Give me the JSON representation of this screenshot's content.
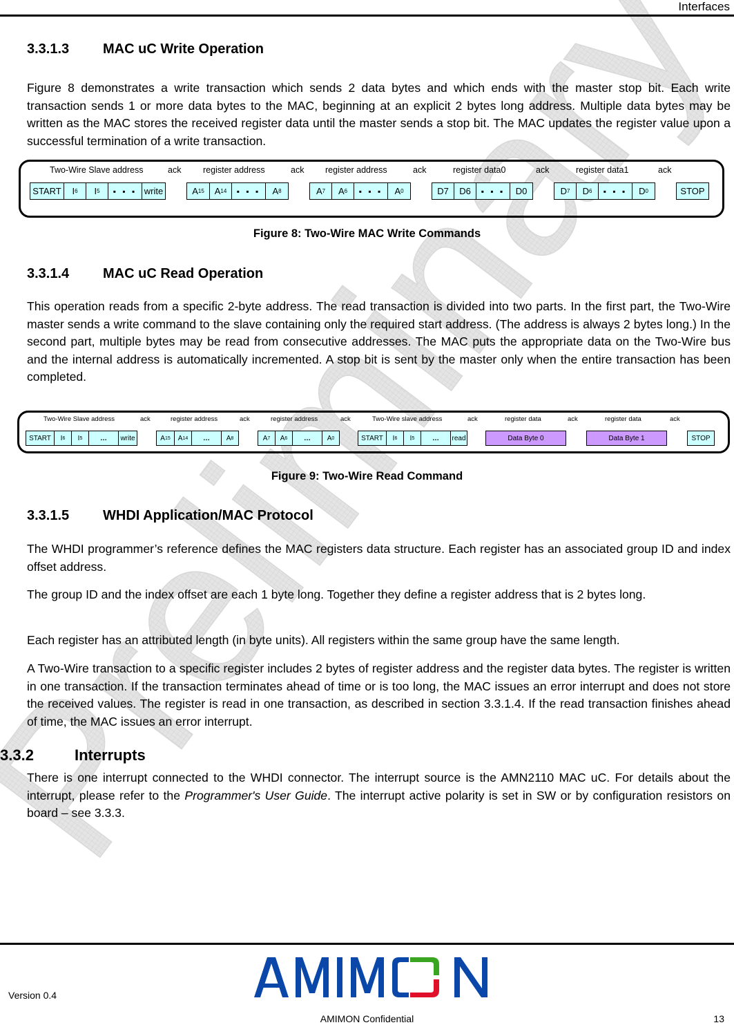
{
  "header": {
    "title": "Interfaces"
  },
  "sections": {
    "s1": {
      "number": "3.3.1.3",
      "title": "MAC uC Write Operation",
      "paragraph": "Figure 8 demonstrates a write transaction which sends 2 data bytes and which ends with the master stop bit. Each write transaction sends 1 or more data bytes to the MAC, beginning at an explicit 2 bytes long address. Multiple data bytes may be written as the MAC stores the received register data until the master sends a stop bit. The MAC updates the register value upon a successful termination of a write transaction."
    },
    "s2": {
      "number": "3.3.1.4",
      "title": "MAC uC Read Operation",
      "paragraph": "This operation reads from a specific 2-byte address. The read transaction is divided into two parts. In the first part, the Two-Wire master sends a write command to the slave containing only the required start address. (The address is always 2 bytes long.) In the second part, multiple bytes may be read from consecutive addresses. The MAC puts the appropriate data on the Two-Wire bus and the internal address is automatically incremented. A stop bit is sent by the master only when the entire transaction has been completed."
    },
    "s3": {
      "number": "3.3.1.5",
      "title": "WHDI Application/MAC Protocol",
      "paragraphs": [
        "The WHDI programmer’s reference defines the MAC registers data structure. Each register has an associated group ID and index offset address.",
        "The group ID and the index offset are each 1 byte long. Together they define a register address that is 2 bytes long.",
        "Each register has an attributed length (in byte units). All registers within the same group have the same length.",
        "A Two-Wire transaction to a specific register includes 2 bytes of register address and the register data bytes. The register is written in one transaction. If the transaction terminates ahead of time or is too long, the MAC issues an error interrupt and does not store the received values. The register is read in one transaction, as described in section 3.3.1.4. If the read transaction finishes ahead of time, the MAC issues an error interrupt."
      ]
    },
    "s4": {
      "number": "3.3.2",
      "title": "Interrupts",
      "paragraph_pre": "There is one interrupt connected to the WHDI connector. The interrupt source is the AMN2110 MAC uC. For details about the interrupt, please refer to the ",
      "paragraph_em": "Programmer's User Guide",
      "paragraph_post": ". The interrupt active polarity is set in SW or by configuration resistors on board – see 3.3.3."
    }
  },
  "figure8": {
    "caption": "Figure 8: Two-Wire MAC Write Commands",
    "labels": [
      "Two-Wire Slave address",
      "ack",
      "register address",
      "ack",
      "register address",
      "ack",
      "register data0",
      "ack",
      "register data1",
      "ack"
    ],
    "cells": {
      "start": "START",
      "i6": "I",
      "i6s": "6",
      "i5": "I",
      "i5s": "5",
      "dots": "▪ ▪ ▪",
      "write": "write",
      "a15": "A",
      "a15s": "15",
      "a14": "A",
      "a14s": "14",
      "a8": "A",
      "a8s": "8",
      "a7": "A",
      "a7s": "7",
      "a6": "A",
      "a6s": "6",
      "a0": "A",
      "a0s": "0",
      "d7": "D7",
      "d6": "D6",
      "d0": "D0",
      "d7b": "D",
      "d7bs": "7",
      "d6b": "D",
      "d6bs": "6",
      "d0b": "D",
      "d0bs": "0",
      "stop": "STOP"
    }
  },
  "figure9": {
    "caption": "Figure 9: Two-Wire Read Command",
    "labels": [
      "Two-Wire Slave address",
      "ack",
      "register address",
      "ack",
      "register address",
      "ack",
      "Two-Wire slave address",
      "ack",
      "register data",
      "ack",
      "register data",
      "ack"
    ],
    "cells": {
      "start": "START",
      "i6": "I",
      "i6s": "6",
      "i5": "I",
      "i5s": "5",
      "dots": "…",
      "write": "write",
      "a15": "A",
      "a15s": "15",
      "a14": "A",
      "a14s": "14",
      "a8": "A",
      "a8s": "8",
      "a7": "A",
      "a7s": "7",
      "a6": "A",
      "a6s": "6",
      "a0": "A",
      "a0s": "0",
      "start2": "START",
      "read": "read",
      "byte0": "Data Byte 0",
      "byte1": "Data Byte 1",
      "stop": "STOP"
    },
    "colors": {
      "address_cell": "#ccffff",
      "data_cell": "#cc99ff"
    }
  },
  "watermark": {
    "text": "Preliminary"
  },
  "footer": {
    "version": "Version 0.4",
    "confidential": "AMIMON Confidential",
    "page": "13",
    "logo_text": "AMIMON",
    "logo_colors": {
      "blue": "#0a47a8",
      "green": "#3aa520",
      "red": "#e0102a"
    }
  }
}
